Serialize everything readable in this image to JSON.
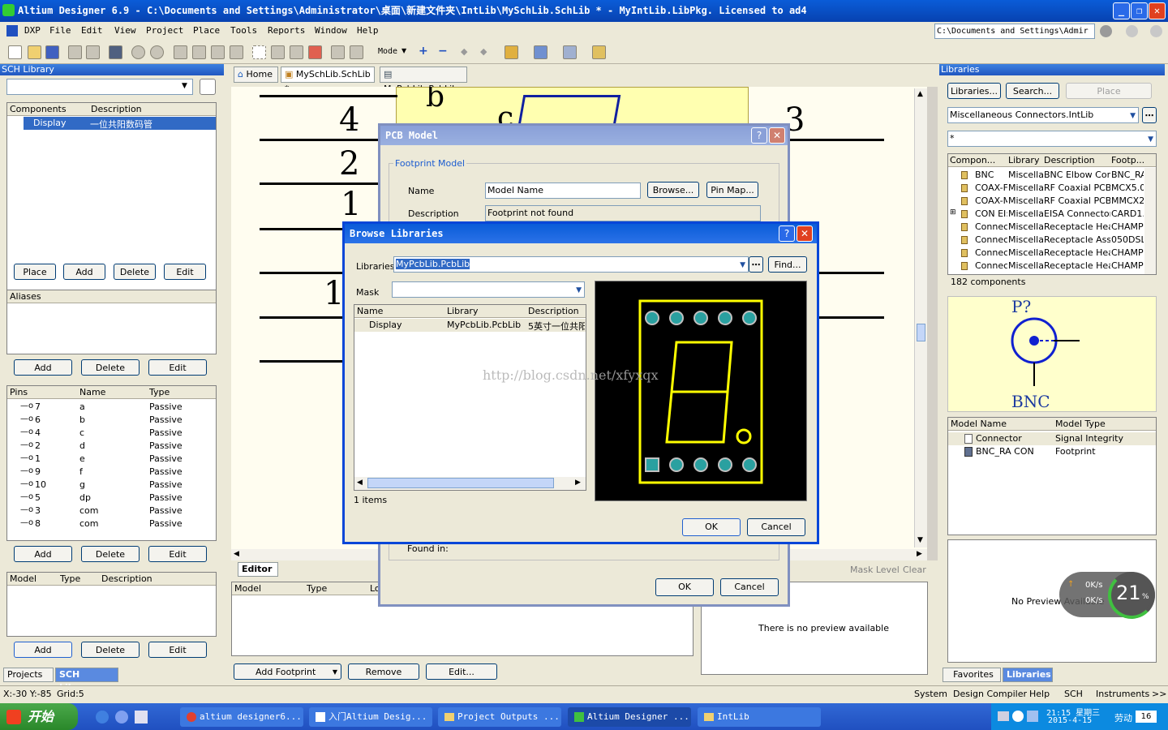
{
  "app": {
    "title": "Altium Designer 6.9 - C:\\Documents and Settings\\Administrator\\桌面\\新建文件夹\\IntLib\\MySchLib.SchLib * - MyIntLib.LibPkg. Licensed to ad4",
    "path_box": "C:\\Documents and Settings\\Admir"
  },
  "menu": [
    "DXP",
    "File",
    "Edit",
    "View",
    "Project",
    "Place",
    "Tools",
    "Reports",
    "Window",
    "Help"
  ],
  "toolbar": {
    "mode_label": "Mode"
  },
  "doc_tabs": [
    {
      "label": "Home"
    },
    {
      "label": "MySchLib.SchLib *"
    },
    {
      "label": "MyPcbLib.PcbLib"
    }
  ],
  "sch_panel": {
    "title": "SCH Library",
    "components_header": [
      "Components",
      "Description"
    ],
    "components": [
      {
        "name": "Display",
        "desc": "一位共阳数码管"
      }
    ],
    "comp_buttons": [
      "Place",
      "Add",
      "Delete",
      "Edit"
    ],
    "aliases_header": "Aliases",
    "alias_buttons": [
      "Add",
      "Delete",
      "Edit"
    ],
    "pins_header": [
      "Pins",
      "Name",
      "Type"
    ],
    "pins": [
      {
        "num": "7",
        "name": "a",
        "type": "Passive"
      },
      {
        "num": "6",
        "name": "b",
        "type": "Passive"
      },
      {
        "num": "4",
        "name": "c",
        "type": "Passive"
      },
      {
        "num": "2",
        "name": "d",
        "type": "Passive"
      },
      {
        "num": "1",
        "name": "e",
        "type": "Passive"
      },
      {
        "num": "9",
        "name": "f",
        "type": "Passive"
      },
      {
        "num": "10",
        "name": "g",
        "type": "Passive"
      },
      {
        "num": "5",
        "name": "dp",
        "type": "Passive"
      },
      {
        "num": "3",
        "name": "com",
        "type": "Passive"
      },
      {
        "num": "8",
        "name": "com",
        "type": "Passive"
      }
    ],
    "pin_buttons": [
      "Add",
      "Delete",
      "Edit"
    ],
    "model_header": [
      "Model",
      "Type",
      "Description"
    ],
    "model_buttons": [
      "Add",
      "Delete",
      "Edit"
    ],
    "bottom_tabs": [
      "Projects",
      "SCH Library"
    ]
  },
  "canvas": {
    "pin_numbers": [
      "4",
      "2",
      "1",
      "1",
      "3"
    ],
    "letters": [
      "b",
      "c"
    ]
  },
  "editor": {
    "tab": "Editor",
    "model_header": [
      "Model",
      "Type",
      "Lo"
    ],
    "buttons": [
      "Add Footprint",
      "Remove",
      "Edit..."
    ],
    "mask_level": "Mask Level",
    "clear": "Clear",
    "no_preview": "There is no preview available"
  },
  "pcb_model_dialog": {
    "title": "PCB Model",
    "group": "Footprint Model",
    "name_label": "Name",
    "name_value": "Model Name",
    "browse_button": "Browse...",
    "pinmap_button": "Pin Map...",
    "desc_label": "Description",
    "desc_value": "Footprint not found",
    "found_in": "Found in:",
    "ok": "OK",
    "cancel": "Cancel"
  },
  "browse_dialog": {
    "title": "Browse Libraries",
    "libraries_label": "Libraries",
    "libraries_value": "MyPcbLib.PcbLib",
    "find_button": "Find...",
    "mask_label": "Mask",
    "headers": [
      "Name",
      "Library",
      "Description"
    ],
    "rows": [
      {
        "name": "Display",
        "library": "MyPcbLib.PcbLib",
        "desc": "5英寸一位共阳"
      }
    ],
    "count": "1 items",
    "watermark": "http://blog.csdn.net/xfyxqx",
    "ok": "OK",
    "cancel": "Cancel"
  },
  "libraries_panel": {
    "title": "Libraries",
    "buttons": [
      "Libraries...",
      "Search...",
      "Place"
    ],
    "library_select": "Miscellaneous Connectors.IntLib",
    "filter": "*",
    "headers": [
      "Compon...",
      "Library",
      "Description",
      "Footp..."
    ],
    "rows": [
      {
        "comp": "BNC",
        "lib": "Miscella",
        "desc": "BNC Elbow Conr",
        "fp": "BNC_RA"
      },
      {
        "comp": "COAX-F",
        "lib": "Miscella",
        "desc": "RF Coaxial PCB I",
        "fp": "MCX5.0"
      },
      {
        "comp": "COAX-M",
        "lib": "Miscella",
        "desc": "RF Coaxial PCB I",
        "fp": "MMCX2"
      },
      {
        "comp": "CON EI:",
        "lib": "Miscella",
        "desc": "EISA Connector,",
        "fp": "CARD1."
      },
      {
        "comp": "Connec",
        "lib": "Miscella",
        "desc": "Receptacle Hea",
        "fp": "CHAMP"
      },
      {
        "comp": "Connec",
        "lib": "Miscella",
        "desc": "Receptacle Asse",
        "fp": "050DSL"
      },
      {
        "comp": "Connec",
        "lib": "Miscella",
        "desc": "Receptacle Hea",
        "fp": "CHAMP"
      },
      {
        "comp": "Connec",
        "lib": "Miscella",
        "desc": "Receptacle Hea",
        "fp": "CHAMP"
      }
    ],
    "count": "182 components",
    "symbol_designator": "P?",
    "symbol_name": "BNC",
    "model_headers": [
      "Model Name",
      "Model Type"
    ],
    "models": [
      {
        "name": "Connector",
        "type": "Signal Integrity"
      },
      {
        "name": "BNC_RA CON",
        "type": "Footprint"
      }
    ],
    "no_preview": "No Preview Available",
    "speed_up": "0K/s",
    "speed_down": "0K/s",
    "gauge_value": "21",
    "gauge_unit": "%",
    "bottom_tabs": [
      "Favorites",
      "Libraries"
    ]
  },
  "status": {
    "coords": "X:-30 Y:-85",
    "grid": "Grid:5",
    "right": [
      "System",
      "Design Compiler",
      "Help",
      "SCH",
      "Instruments",
      ">>"
    ]
  },
  "taskbar": {
    "start": "开始",
    "tasks": [
      "altium designer6...",
      "入门Altium Desig...",
      "Project Outputs ...",
      "Altium Designer ...",
      "IntLib"
    ],
    "time": "21:15 星期三",
    "date": "2015-4-15",
    "ime": "劳动",
    "ime_num": "16"
  }
}
